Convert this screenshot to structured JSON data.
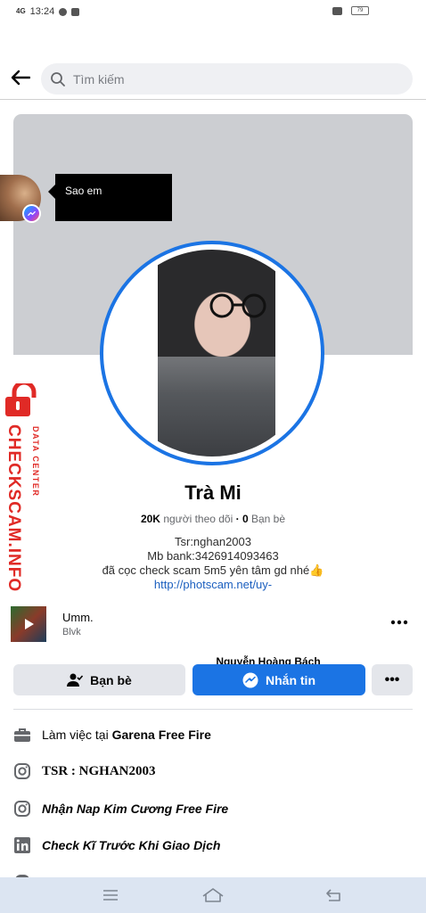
{
  "status_bar": {
    "network": "4G",
    "time": "13:24",
    "battery": "79"
  },
  "header": {
    "back_icon": "arrow-left-icon",
    "search_placeholder": "Tìm kiếm"
  },
  "chat_head": {
    "sender": "Nguyễn Hoàng Bách",
    "message": "Sao em"
  },
  "watermark": {
    "brand": "CHECKSCAM.INFO",
    "tagline": "DATA CENTER",
    "color": "#e02a26"
  },
  "profile": {
    "name": "Trà Mi",
    "followers_count": "20K",
    "followers_label": "người theo dõi",
    "separator": "·",
    "friends_count": "0",
    "friends_label": "Bạn bè",
    "bio_lines": [
      "Tsr:nghan2003",
      "Mb bank:3426914093463",
      "đã cọc check scam 5m5 yên tâm gd nhé👍"
    ],
    "bio_link": "http://photscam.net/uy-"
  },
  "music": {
    "title": "Umm.",
    "artist": "Blvk",
    "more_icon": "more-dots-icon"
  },
  "actions": {
    "friends_label": "Bạn bè",
    "message_label": "Nhắn tin",
    "more_label": "•••",
    "accent_color": "#1b74e4"
  },
  "info": {
    "work_prefix": "Làm việc tại",
    "work_place": "Garena Free Fire",
    "instagram_1": "TSR : NGHAN2003",
    "instagram_2": "Nhận Nap Kim Cương Free Fire",
    "linkedin": "Check Kĩ Trước Khi Giao Dịch"
  }
}
